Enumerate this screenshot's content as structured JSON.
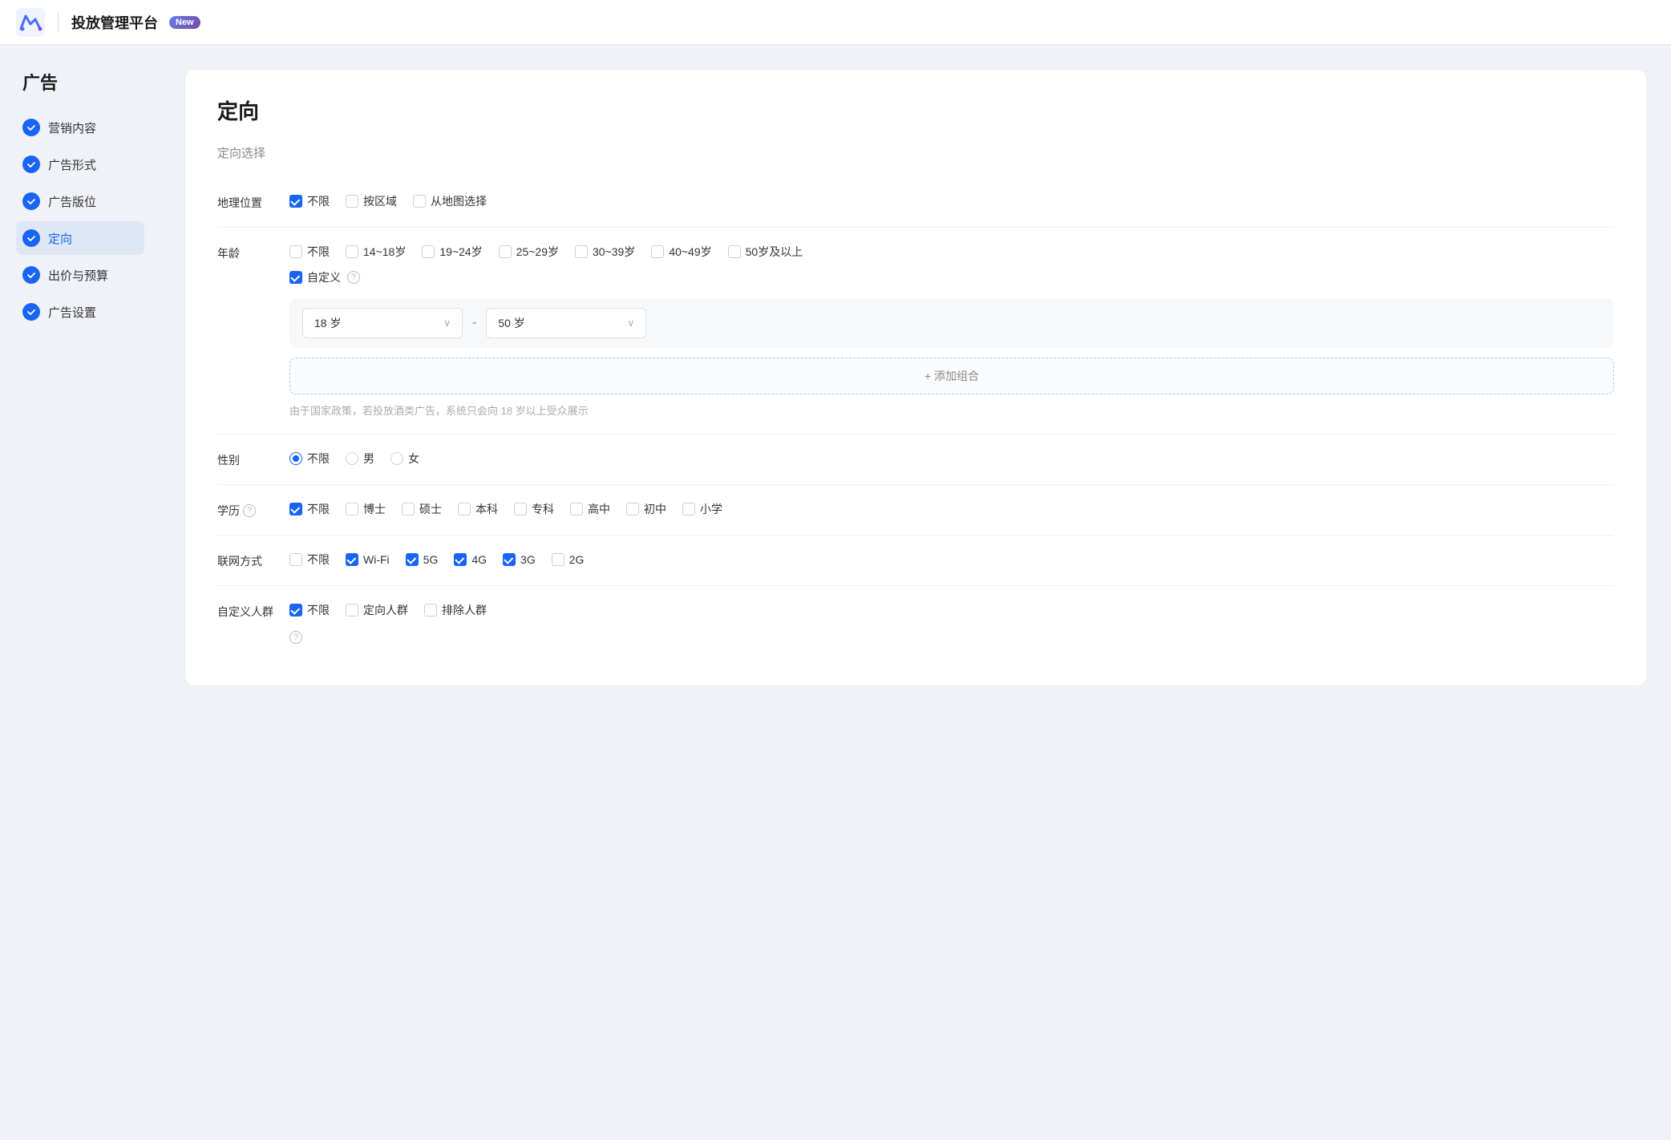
{
  "header": {
    "title": "投放管理平台",
    "badge": "New",
    "logo_alt": "logo"
  },
  "sidebar": {
    "section_title": "广告",
    "items": [
      {
        "id": "marketing",
        "label": "营销内容",
        "active": false,
        "completed": true
      },
      {
        "id": "ad-format",
        "label": "广告形式",
        "active": false,
        "completed": true
      },
      {
        "id": "ad-placement",
        "label": "广告版位",
        "active": false,
        "completed": true
      },
      {
        "id": "targeting",
        "label": "定向",
        "active": true,
        "completed": true
      },
      {
        "id": "bidding",
        "label": "出价与预算",
        "active": false,
        "completed": true
      },
      {
        "id": "ad-settings",
        "label": "广告设置",
        "active": false,
        "completed": true
      }
    ]
  },
  "form": {
    "title": "定向",
    "section_label": "定向选择",
    "rows": {
      "location": {
        "label": "地理位置",
        "options": [
          {
            "id": "loc-all",
            "text": "不限",
            "checked": true
          },
          {
            "id": "loc-region",
            "text": "按区域",
            "checked": false
          },
          {
            "id": "loc-map",
            "text": "从地图选择",
            "checked": false
          }
        ]
      },
      "age": {
        "label": "年龄",
        "options": [
          {
            "id": "age-all",
            "text": "不限",
            "checked": false
          },
          {
            "id": "age-14-18",
            "text": "14~18岁",
            "checked": false
          },
          {
            "id": "age-19-24",
            "text": "19~24岁",
            "checked": false
          },
          {
            "id": "age-25-29",
            "text": "25~29岁",
            "checked": false
          },
          {
            "id": "age-30-39",
            "text": "30~39岁",
            "checked": false
          },
          {
            "id": "age-40-49",
            "text": "40~49岁",
            "checked": false
          },
          {
            "id": "age-50plus",
            "text": "50岁及以上",
            "checked": false
          }
        ],
        "custom": {
          "enabled": true,
          "label": "自定义",
          "from_value": "18 岁",
          "to_value": "50 岁",
          "separator": "-",
          "add_group_label": "+ 添加组合",
          "notice": "由于国家政策，若投放酒类广告，系统只会向 18 岁以上受众展示"
        }
      },
      "gender": {
        "label": "性别",
        "options": [
          {
            "id": "gender-all",
            "text": "不限",
            "checked": true
          },
          {
            "id": "gender-male",
            "text": "男",
            "checked": false
          },
          {
            "id": "gender-female",
            "text": "女",
            "checked": false
          }
        ]
      },
      "education": {
        "label": "学历",
        "has_help": true,
        "options": [
          {
            "id": "edu-all",
            "text": "不限",
            "checked": true
          },
          {
            "id": "edu-phd",
            "text": "博士",
            "checked": false
          },
          {
            "id": "edu-master",
            "text": "硕士",
            "checked": false
          },
          {
            "id": "edu-bachelor",
            "text": "本科",
            "checked": false
          },
          {
            "id": "edu-college",
            "text": "专科",
            "checked": false
          },
          {
            "id": "edu-highschool",
            "text": "高中",
            "checked": false
          },
          {
            "id": "edu-middle",
            "text": "初中",
            "checked": false
          },
          {
            "id": "edu-primary",
            "text": "小学",
            "checked": false
          }
        ]
      },
      "network": {
        "label": "联网方式",
        "options": [
          {
            "id": "net-all",
            "text": "不限",
            "checked": false
          },
          {
            "id": "net-wifi",
            "text": "Wi-Fi",
            "checked": true
          },
          {
            "id": "net-5g",
            "text": "5G",
            "checked": true
          },
          {
            "id": "net-4g",
            "text": "4G",
            "checked": true
          },
          {
            "id": "net-3g",
            "text": "3G",
            "checked": true
          },
          {
            "id": "net-2g",
            "text": "2G",
            "checked": false
          }
        ]
      },
      "custom_audience": {
        "label": "自定义人群",
        "options": [
          {
            "id": "aud-all",
            "text": "不限",
            "checked": true
          },
          {
            "id": "aud-targeted",
            "text": "定向人群",
            "checked": false
          },
          {
            "id": "aud-excluded",
            "text": "排除人群",
            "checked": false
          }
        ],
        "has_help_bottom": true
      }
    }
  },
  "icons": {
    "checkmark": "✓",
    "plus": "+",
    "chevron_down": "∨",
    "question": "?",
    "separator": "-"
  }
}
